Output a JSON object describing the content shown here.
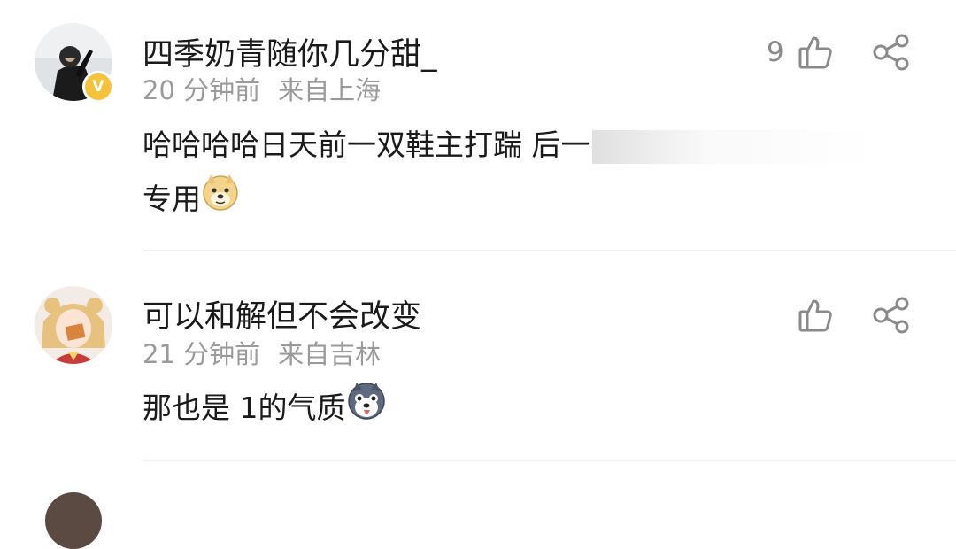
{
  "comments": [
    {
      "username": "四季奶青随你几分甜_",
      "time": "20 分钟前",
      "location": "来自上海",
      "content_line1": "哈哈哈哈日天前一双鞋主打踹 后一",
      "content_line2": "专用",
      "like_count": "9",
      "verified_badge": "V"
    },
    {
      "username": "可以和解但不会改变",
      "time": "21 分钟前",
      "location": "来自吉林",
      "content_line1": "那也是 1的气质",
      "like_count": ""
    }
  ],
  "icons": {
    "like": "thumbs-up-icon",
    "share": "share-icon",
    "emoji1": "doge-emoji",
    "emoji2": "husky-emoji"
  },
  "colors": {
    "badge": "#f5c33b",
    "text_primary": "#1a1a1a",
    "text_secondary": "#9a9a9a",
    "icon": "#8a8a8a"
  }
}
